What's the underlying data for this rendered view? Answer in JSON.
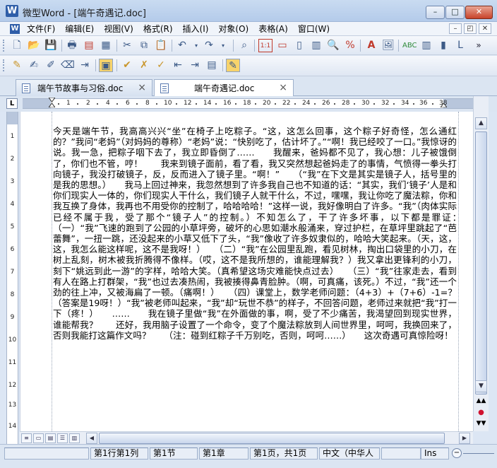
{
  "window": {
    "app_icon": "W",
    "title": "微型Word - [端午奇遇记.doc]",
    "controls": {
      "minimize": "–",
      "maximize": "□",
      "close": "✕"
    }
  },
  "menubar": {
    "items": [
      "文件(F)",
      "编辑(E)",
      "视图(V)",
      "格式(R)",
      "插入(I)",
      "对象(O)",
      "表格(A)",
      "窗口(W)"
    ],
    "mdi": {
      "minimize": "–",
      "restore": "◰",
      "close": "✕"
    }
  },
  "tabs": [
    {
      "label": "端午节故事与习俗.doc",
      "close": "×"
    },
    {
      "label": "端午奇遇记.doc",
      "close": "×"
    }
  ],
  "ruler": {
    "corner": "L",
    "h_numbers": [
      "1",
      "2",
      "4",
      "6",
      "8",
      "10",
      "12",
      "14",
      "16",
      "18",
      "20",
      "22",
      "24",
      "26",
      "28",
      "30",
      "32",
      "34",
      "36",
      "38"
    ],
    "v_numbers": [
      "1",
      "2",
      "3",
      "4",
      "5",
      "6",
      "7",
      "8",
      "9",
      "10",
      "11",
      "12",
      "13",
      "14"
    ]
  },
  "document": {
    "text": "今天是端午节，我高高兴兴“坐”在椅子上吃粽子。“这，这怎么回事，这个粽子好奇怪，怎么通红的？”我问“老妈”（对妈妈的尊称）“老妈”说：“快别吃了，估计坏了。”“啊！我已经咬了一口。”我惊讶的说。我一急，把粽子咽下去了，我立即昏倒了……　　我醒来，爸妈都不见了，我心想：儿子被饿倒了，你们也不管，哼！　　我来到镜子面前，看了看，我又突然想起爸妈走了的事情，气愤得一拳头打向镜子，我没打破镜子，反，反而进入了镜子里。“啊！”　　（“我”在下文是其实是镜子人，括号里的是我的思想。）　　我马上回过神来，我忽然想到了许多我自己也不知道的话：“其实，我们‘镜子’人是和你们现实人一体的，你们现实人干什么，我们镜子人就干什么，不过，嘿嘿，我让你吃了魔法粽，你和我互换了身体，我再也不用受你的控制了，哈哈哈哈！”这样一说，我好像明白了许多。“我”（肉体实际已经不属于我，受了那个“镜子人”的控制。）不知怎么了，干了许多坏事，以下都是罪证：　　（一）“我”飞速的跑到了公园的小草坪旁，破坏的心思如潮水般涌来，穿过护栏，在草坪里跳起了“芭蕾舞”，一扭一跳，还没起来的小草又低下了头，“我”像收了许多奴隶似的，哈哈大笑起来。（天，这，这，我怎么能这样呢，这不是我呀！）　　（二）“我”在公园里乱跑，看见树林，掏出口袋里的小刀，在树上乱刻，树木被我折腾得不像样。（哎，这不是我所想的，谁能理解我？）我又拿出更锋利的小刀，刻下“姚远到此一游”的字样，哈哈大笑。（真希望这场灾难能快点过去）　　（三）“我”往家走去，看到有人在路上打群架，“我”也过去凑热闹，我被揍得鼻青脸肿。（啊，可真痛，该死。）不过，“我”还一个劲的往上冲，又被海扁了一顿。（痛啊！）　　（四）课堂上，数学老师问题：（4+3）+（7+6）-1=？（答案是19呀！）“我”被老师叫起来，“我”却“玩世不恭”的样子，不回答问题，老师过来就把“我”打一下（疼！）　　……　　我在镜子里做“我”在外面做的事，啊，受了不少痛苦，我渴望回到现实世界，谁能帮我？　　还好，我用脑子设置了一个命令，变了个魔法粽放到人间世界里，呵呵，我换回来了，否则我能打这篇作文吗？　　（注：碰到红粽子千万别吃，否则，呵呵……）　　这次奇遇可真惊险呀！"
  },
  "statusbar": {
    "cells": [
      "第1行第1列",
      "第1节",
      "第1章",
      "第1页，共1页",
      "中文（中华人",
      "Ins"
    ],
    "zoom_minus": "−"
  }
}
